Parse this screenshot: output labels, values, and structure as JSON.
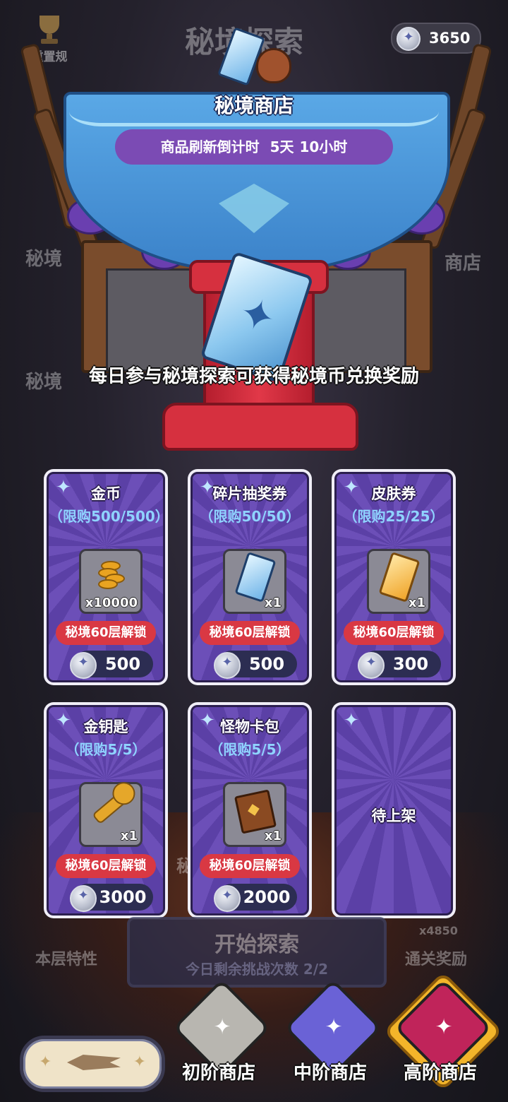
{
  "background": {
    "ghost_title": "秘境探索",
    "ghost_left_1": "秘境",
    "ghost_left_2": "秘境",
    "ghost_right": "商店",
    "ghost_side": "秘",
    "layer_feature": "本层特性",
    "clear_reward": "通关奖励",
    "clear_reward_count": "x4850"
  },
  "top_bar": {
    "reset_rules_label": "重置规",
    "currency_value": "3650"
  },
  "shop": {
    "title": "秘境商店",
    "countdown_label": "商品刷新倒计时",
    "countdown_days": "5天",
    "countdown_hours": "10小时",
    "info": "每日参与秘境探索可获得秘境币兑换奖励"
  },
  "items": [
    {
      "name": "金币",
      "limit": "（限购500/500）",
      "qty": "x10000",
      "lock": "秘境60层解锁",
      "price": "500"
    },
    {
      "name": "碎片抽奖券",
      "limit": "（限购50/50）",
      "qty": "x1",
      "lock": "秘境60层解锁",
      "price": "500"
    },
    {
      "name": "皮肤券",
      "limit": "（限购25/25）",
      "qty": "x1",
      "lock": "秘境60层解锁",
      "price": "300"
    },
    {
      "name": "金钥匙",
      "limit": "（限购5/5）",
      "qty": "x1",
      "lock": "秘境60层解锁",
      "price": "3000"
    },
    {
      "name": "怪物卡包",
      "limit": "（限购5/5）",
      "qty": "x1",
      "lock": "秘境60层解锁",
      "price": "2000"
    },
    {
      "pending": "待上架"
    }
  ],
  "start": {
    "title": "开始探索",
    "subtitle": "今日剩余挑战次数 2/2"
  },
  "tiers": [
    {
      "label": "初阶商店",
      "color": "#b8b6b0"
    },
    {
      "label": "中阶商店",
      "color": "#6a62d6"
    },
    {
      "label": "高阶商店",
      "color": "#c0245a",
      "active": true
    }
  ],
  "colors": {
    "card_bg": "#6c4fb8",
    "lock_red": "#d93843",
    "limit_blue": "#8fd3ff",
    "countdown_purple": "#7b4bb4"
  }
}
